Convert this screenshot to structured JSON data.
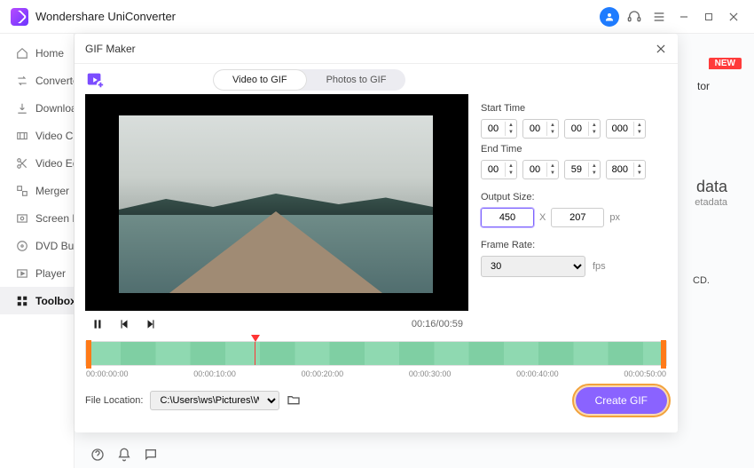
{
  "app": {
    "title": "Wondershare UniConverter"
  },
  "titlebar_icons": {
    "avatar_initial": ""
  },
  "sidebar": {
    "items": [
      {
        "label": "Home"
      },
      {
        "label": "Converter"
      },
      {
        "label": "Downloader"
      },
      {
        "label": "Video Compressor"
      },
      {
        "label": "Video Editor"
      },
      {
        "label": "Merger"
      },
      {
        "label": "Screen Recorder"
      },
      {
        "label": "DVD Burner"
      },
      {
        "label": "Player"
      },
      {
        "label": "Toolbox"
      }
    ]
  },
  "background": {
    "new_badge": "NEW",
    "tor_suffix": "tor",
    "data_title": "data",
    "data_sub": "etadata",
    "cd_suffix": "CD."
  },
  "modal": {
    "title": "GIF Maker",
    "tabs": {
      "video": "Video to GIF",
      "photos": "Photos to GIF"
    },
    "start_label": "Start Time",
    "end_label": "End Time",
    "start": {
      "h": "00",
      "m": "00",
      "s": "00",
      "ms": "000"
    },
    "end": {
      "h": "00",
      "m": "00",
      "s": "59",
      "ms": "800"
    },
    "output_label": "Output Size:",
    "output": {
      "w": "450",
      "x": "X",
      "h": "207",
      "unit": "px"
    },
    "frame_label": "Frame Rate:",
    "frame_rate": "30",
    "fps_unit": "fps",
    "time_display": "00:16/00:59",
    "ticks": [
      "00:00:00:00",
      "00:00:10:00",
      "00:00:20:00",
      "00:00:30:00",
      "00:00:40:00",
      "00:00:50:00"
    ],
    "file_label": "File Location:",
    "file_path": "C:\\Users\\ws\\Pictures\\Wonders",
    "create_label": "Create GIF"
  }
}
